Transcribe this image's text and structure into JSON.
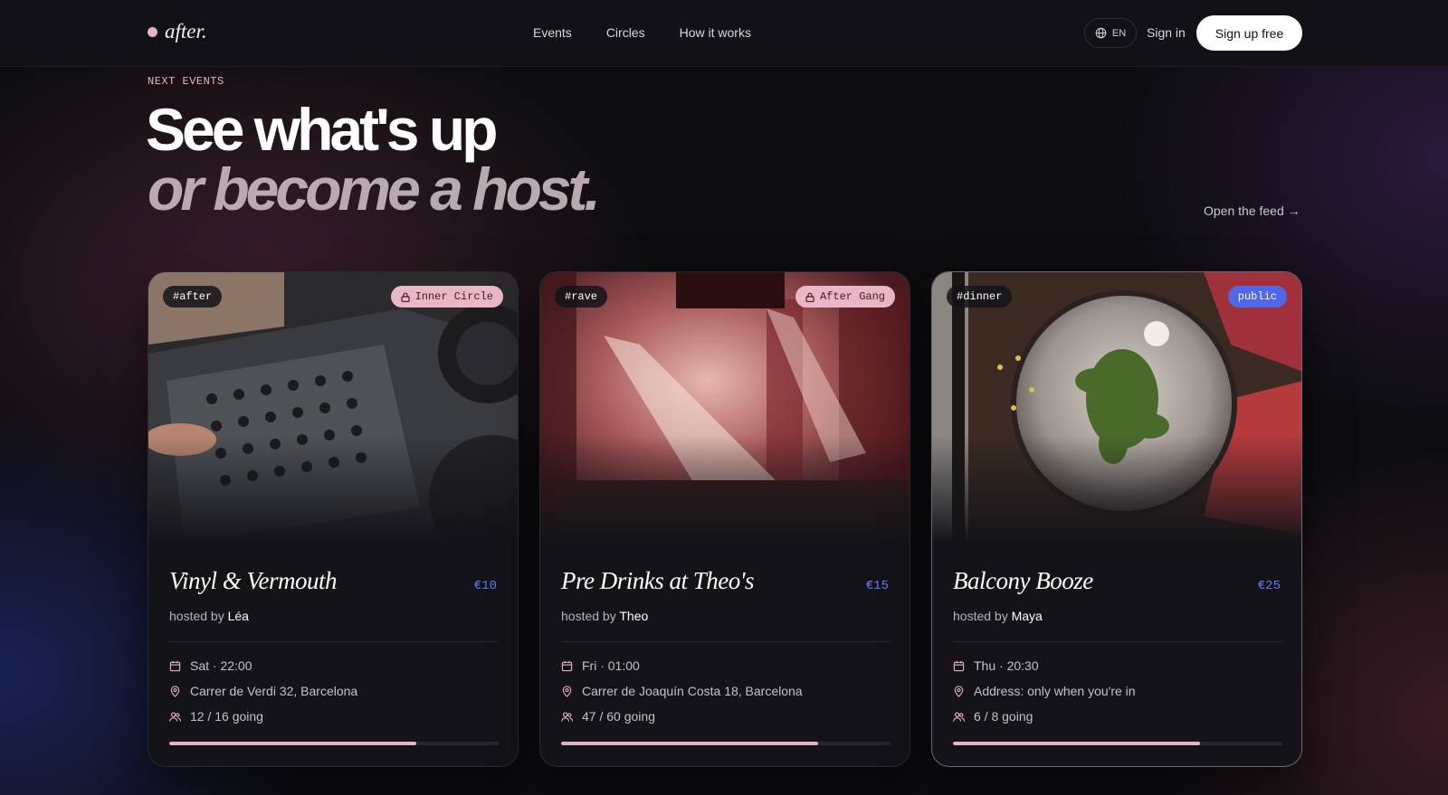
{
  "nav": {
    "logo": "after.",
    "links": [
      "Events",
      "Circles",
      "How it works"
    ],
    "lang": "EN",
    "signin": "Sign in",
    "signup": "Sign up free"
  },
  "hero": {
    "eyebrow": "NEXT EVENTS",
    "line1": "See what's up",
    "line2": "or become a host.",
    "feed_link": "Open the feed →"
  },
  "colors": {
    "accent_pink": "#e6b3c4",
    "accent_blue": "#5f7cf0",
    "card_bg": "#141418"
  },
  "events": [
    {
      "tag": "#after",
      "badge": "Inner Circle",
      "badge_style": "pink-lock",
      "title": "Vinyl & Vermouth",
      "price": "€10",
      "hosted_by": "hosted by",
      "host": "Léa",
      "date": "Sat · 22:00",
      "location": "Carrer de Verdi 32, Barcelona",
      "going": "12 / 16 going",
      "fill_fraction": 0.75
    },
    {
      "tag": "#rave",
      "badge": "After Gang",
      "badge_style": "pink-lock",
      "title": "Pre Drinks at Theo's",
      "price": "€15",
      "hosted_by": "hosted by",
      "host": "Theo",
      "date": "Fri · 01:00",
      "location": "Carrer de Joaquín Costa 18, Barcelona",
      "going": "47 / 60 going",
      "fill_fraction": 0.78
    },
    {
      "tag": "#dinner",
      "badge": "public",
      "badge_style": "blue",
      "title": "Balcony Booze",
      "price": "€25",
      "hosted_by": "hosted by",
      "host": "Maya",
      "date": "Thu · 20:30",
      "location": "Address: only when you're in",
      "going": "6 / 8 going",
      "fill_fraction": 0.75
    }
  ]
}
